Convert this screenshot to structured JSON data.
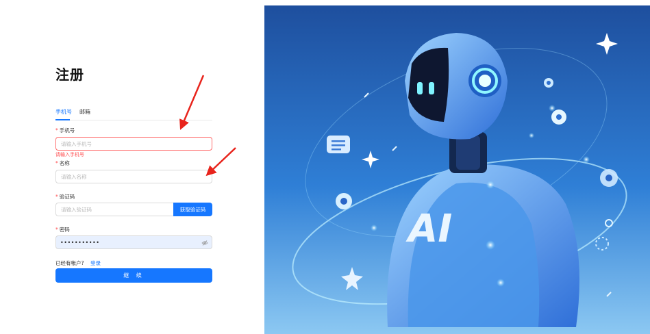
{
  "form": {
    "title": "注册",
    "tabs": [
      {
        "label": "手机号",
        "active": true
      },
      {
        "label": "邮箱",
        "active": false
      }
    ],
    "fields": {
      "phone": {
        "label": "手机号",
        "placeholder": "请输入手机号",
        "error": "请输入手机号"
      },
      "name": {
        "label": "名称",
        "placeholder": "请输入名称"
      },
      "code": {
        "label": "验证码",
        "placeholder": "请输入验证码",
        "button": "获取验证码"
      },
      "password": {
        "label": "密码",
        "value": "•••••••••••"
      }
    },
    "footer": {
      "has_account": "已经有帐户?",
      "login": "登录"
    },
    "submit": "继 续"
  },
  "hero": {
    "badge_text": "AI"
  },
  "colors": {
    "primary": "#1677ff",
    "error": "#ff4d4f",
    "annotation_arrow": "#e8241c"
  }
}
